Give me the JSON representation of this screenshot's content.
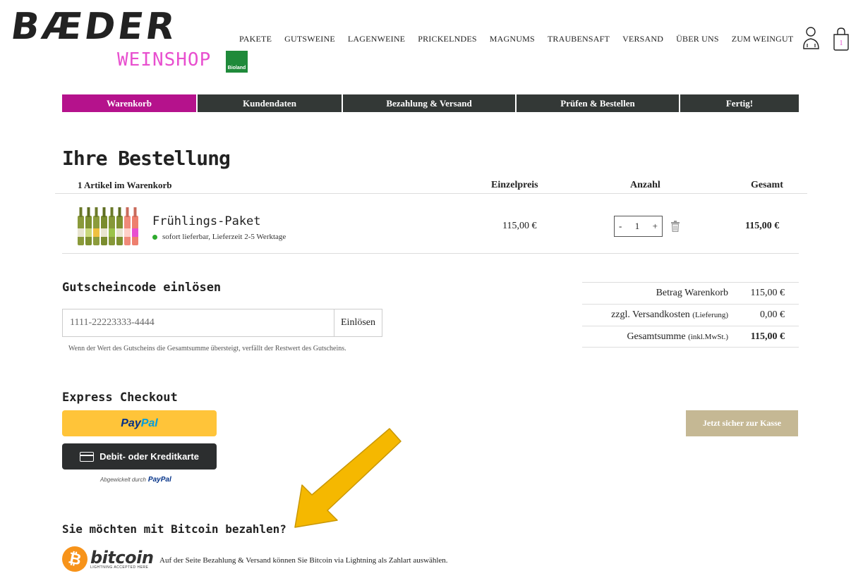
{
  "brand": {
    "logo_main": "BÆDER",
    "logo_sub": "WEINSHOP",
    "bioland": "Bioland"
  },
  "nav": {
    "items": [
      "PAKETE",
      "GUTSWEINE",
      "LAGENWEINE",
      "PRICKELNDES",
      "MAGNUMS",
      "TRAUBENSAFT",
      "VERSAND",
      "ÜBER UNS",
      "ZUM WEINGUT"
    ],
    "cart_count": "1"
  },
  "steps": [
    {
      "label": "Warenkorb",
      "active": true
    },
    {
      "label": "Kundendaten",
      "active": false
    },
    {
      "label": "Bezahlung & Versand",
      "active": false
    },
    {
      "label": "Prüfen & Bestellen",
      "active": false
    },
    {
      "label": "Fertig!",
      "active": false
    }
  ],
  "page_title": "Ihre Bestellung",
  "table": {
    "items_count_label": "1 Artikel im Warenkorb",
    "col_price": "Einzelpreis",
    "col_qty": "Anzahl",
    "col_total": "Gesamt"
  },
  "cart_item": {
    "name": "Frühlings-Paket",
    "availability": "sofort lieferbar, Lieferzeit 2-5 Werktage",
    "price": "115,00 €",
    "qty": "1",
    "minus": "-",
    "plus": "+",
    "total": "115,00 €"
  },
  "coupon": {
    "title": "Gutscheincode einlösen",
    "placeholder": "1111-22223333-4444",
    "button": "Einlösen",
    "note": "Wenn der Wert des Gutscheins die Gesamtsumme übersteigt, verfällt der Restwert des Gutscheins."
  },
  "summary": {
    "cart_label": "Betrag Warenkorb",
    "cart_value": "115,00 €",
    "shipping_label": "zzgl. Versandkosten",
    "shipping_note": "(Lieferung)",
    "shipping_value": "0,00 €",
    "total_label": "Gesamtsumme",
    "total_note": "(inkl.MwSt.)",
    "total_value": "115,00 €"
  },
  "express": {
    "title": "Express Checkout",
    "paypal_pay": "Pay",
    "paypal_pal": "Pal",
    "card_label": "Debit- oder Kreditkarte",
    "processed_by": "Abgewickelt durch",
    "processed_brand": "PayPal"
  },
  "checkout_button": "Jetzt sicher zur Kasse",
  "bitcoin": {
    "title": "Sie möchten mit Bitcoin bezahlen?",
    "symbol": "₿",
    "word": "bitcoin",
    "slogan": "LIGHTNING ACCEPTED HERE",
    "text": "Auf der Seite Bezahlung & Versand können Sie Bitcoin via Lightning als Zahlart auswählen."
  },
  "colors": {
    "accent": "#b5128c",
    "step_dark": "#333836",
    "checkout": "#c5b894",
    "paypal_yellow": "#ffc439",
    "arrow": "#f5b800",
    "bitcoin_orange": "#f7931a"
  }
}
